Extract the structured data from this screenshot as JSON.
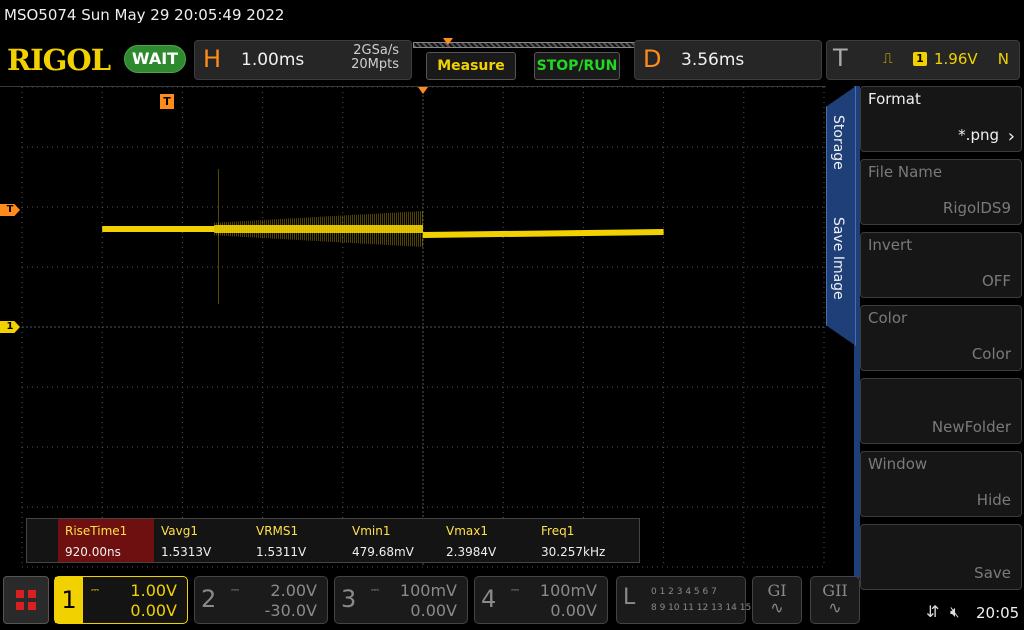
{
  "title": "MSO5074  Sun May 29 20:05:49 2022",
  "header": {
    "logo": "RIGOL",
    "status": "WAIT",
    "horizontal": {
      "letter": "H",
      "time_per_div": "1.00ms",
      "sample_rate": "2GSa/s",
      "memory_depth": "20Mpts"
    },
    "measure_label": "Measure",
    "stoprun_label": "STOP/RUN",
    "delay": {
      "letter": "D",
      "value": "3.56ms"
    },
    "trigger": {
      "letter": "T",
      "edge_icon": "rising-edge-icon",
      "edge_glyph": "⎍",
      "source": "1",
      "level": "1.96V",
      "mode": "N"
    }
  },
  "markers": {
    "trigger_side": "T",
    "ch1_side": "1",
    "trigger_position": "T"
  },
  "measurements": [
    {
      "label": "RiseTime1",
      "value": "920.00ns",
      "active": true
    },
    {
      "label": "Vavg1",
      "value": "1.5313V"
    },
    {
      "label": "VRMS1",
      "value": "1.5311V"
    },
    {
      "label": "Vmin1",
      "value": "479.68mV"
    },
    {
      "label": "Vmax1",
      "value": "2.3984V"
    },
    {
      "label": "Freq1",
      "value": "30.257kHz"
    }
  ],
  "menu": {
    "tabs": [
      "Storage",
      "Save Image"
    ],
    "items": [
      {
        "title": "Format",
        "value": "*.png",
        "enabled": true,
        "chevron": "›"
      },
      {
        "title": "File Name",
        "value": "RigolDS9",
        "enabled": false
      },
      {
        "title": "Invert",
        "value": "OFF",
        "enabled": false
      },
      {
        "title": "Color",
        "value": "Color",
        "enabled": false
      },
      {
        "title": "",
        "value": "NewFolder",
        "enabled": false
      },
      {
        "title": "Window",
        "value": "Hide",
        "enabled": false
      },
      {
        "title": "",
        "value": "Save",
        "enabled": false
      }
    ]
  },
  "channels": [
    {
      "num": "1",
      "coupling": "DC",
      "coupling_glyph": "⎓",
      "scale": "1.00V",
      "offset": "0.00V",
      "active": true
    },
    {
      "num": "2",
      "coupling": "DC",
      "coupling_glyph": "⎓",
      "scale": "2.00V",
      "offset": "-30.0V",
      "active": false
    },
    {
      "num": "3",
      "coupling": "DC",
      "coupling_glyph": "⎓",
      "scale": "100mV",
      "offset": "0.00V",
      "active": false
    },
    {
      "num": "4",
      "coupling": "DC",
      "coupling_glyph": "⎓",
      "scale": "100mV",
      "offset": "0.00V",
      "active": false
    }
  ],
  "logic": {
    "letter": "L",
    "row1": "0 1 2 3   4 5 6 7",
    "row2": "8 9 10 11  12 13 14 15"
  },
  "generators": [
    {
      "name": "GI",
      "wave": "∿"
    },
    {
      "name": "GII",
      "wave": "∿"
    }
  ],
  "status_bar": {
    "usb_icon": "usb-icon",
    "speaker_icon": "speaker-muted-icon",
    "time": "20:05"
  },
  "colors": {
    "ch1": "#f2d100",
    "trigger": "#ff8c1a",
    "menu_blue": "#1f3f78",
    "run_green": "#23d823"
  },
  "waveform": {
    "channel": "1",
    "description_free": true,
    "segments": [
      {
        "t_start_div": -4.0,
        "t_end_div": -2.6,
        "level_div": 0.0,
        "ripple_div": 0.02
      },
      {
        "t_start_div": -2.6,
        "t_end_div": 0.0,
        "level_div": 0.0,
        "ripple_div": 0.3
      },
      {
        "t_start_div": 0.0,
        "t_end_div": 3.0,
        "level_div": -0.1,
        "ripple_div": 0.02,
        "slope_div": 0.05
      }
    ]
  }
}
